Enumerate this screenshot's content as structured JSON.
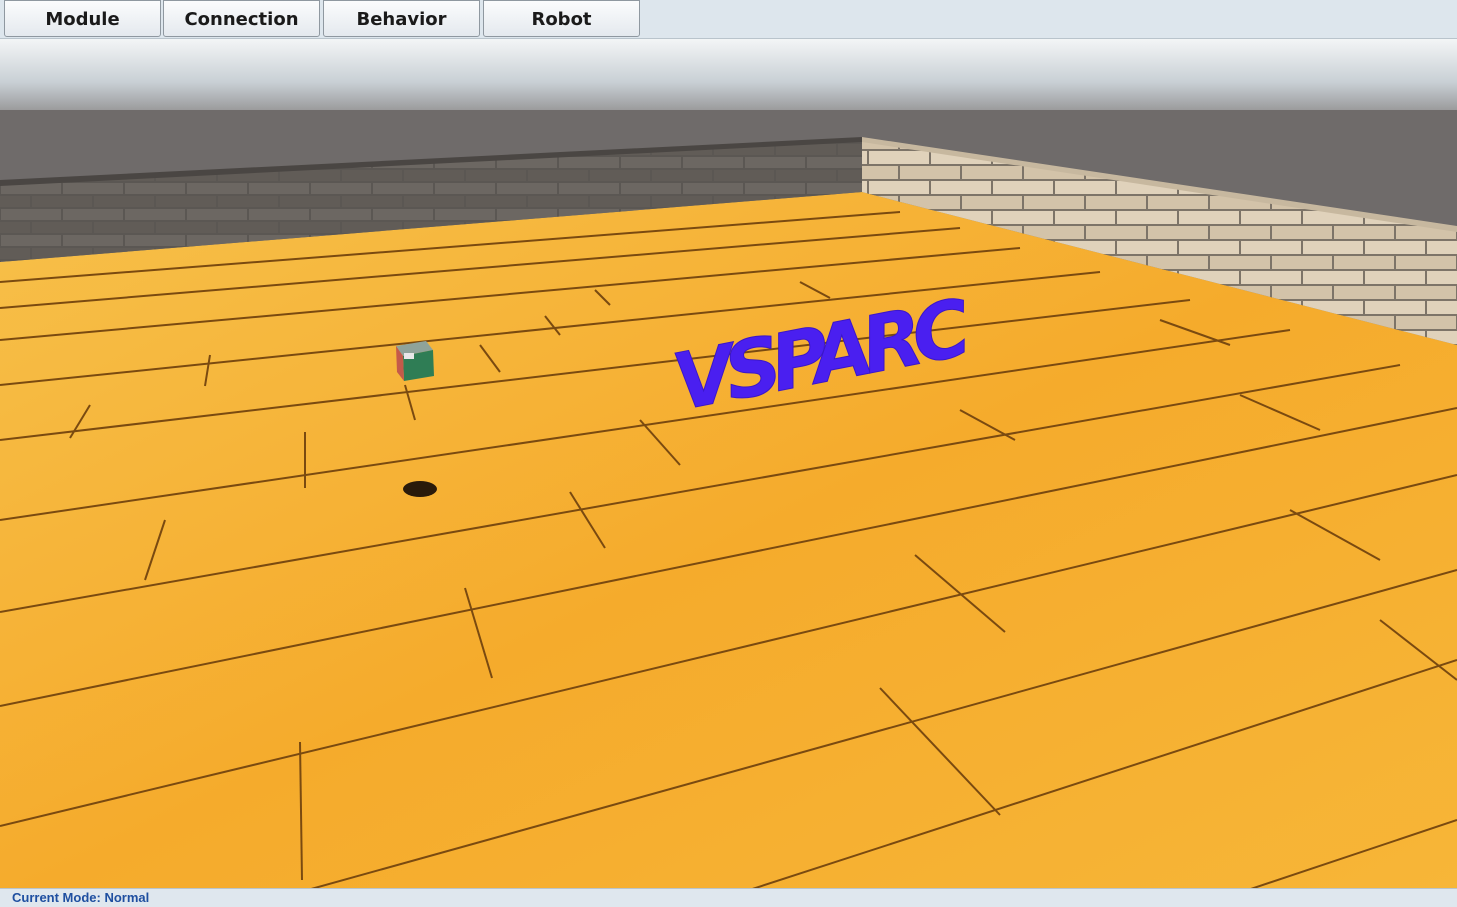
{
  "menu": {
    "items": [
      {
        "label": "Module"
      },
      {
        "label": "Connection"
      },
      {
        "label": "Behavior"
      },
      {
        "label": "Robot"
      }
    ]
  },
  "scene": {
    "logo_text": "VSPARC",
    "colors": {
      "sky": "#d6dde2",
      "horizon": "#6b6867",
      "floor": "#f2a92c",
      "wall_left": "#56524e",
      "wall_right": "#d8c9b2",
      "logo": "#4a1ff0",
      "robot": "#2f7d55"
    }
  },
  "status": {
    "label": "Current Mode:",
    "mode": "Normal"
  }
}
